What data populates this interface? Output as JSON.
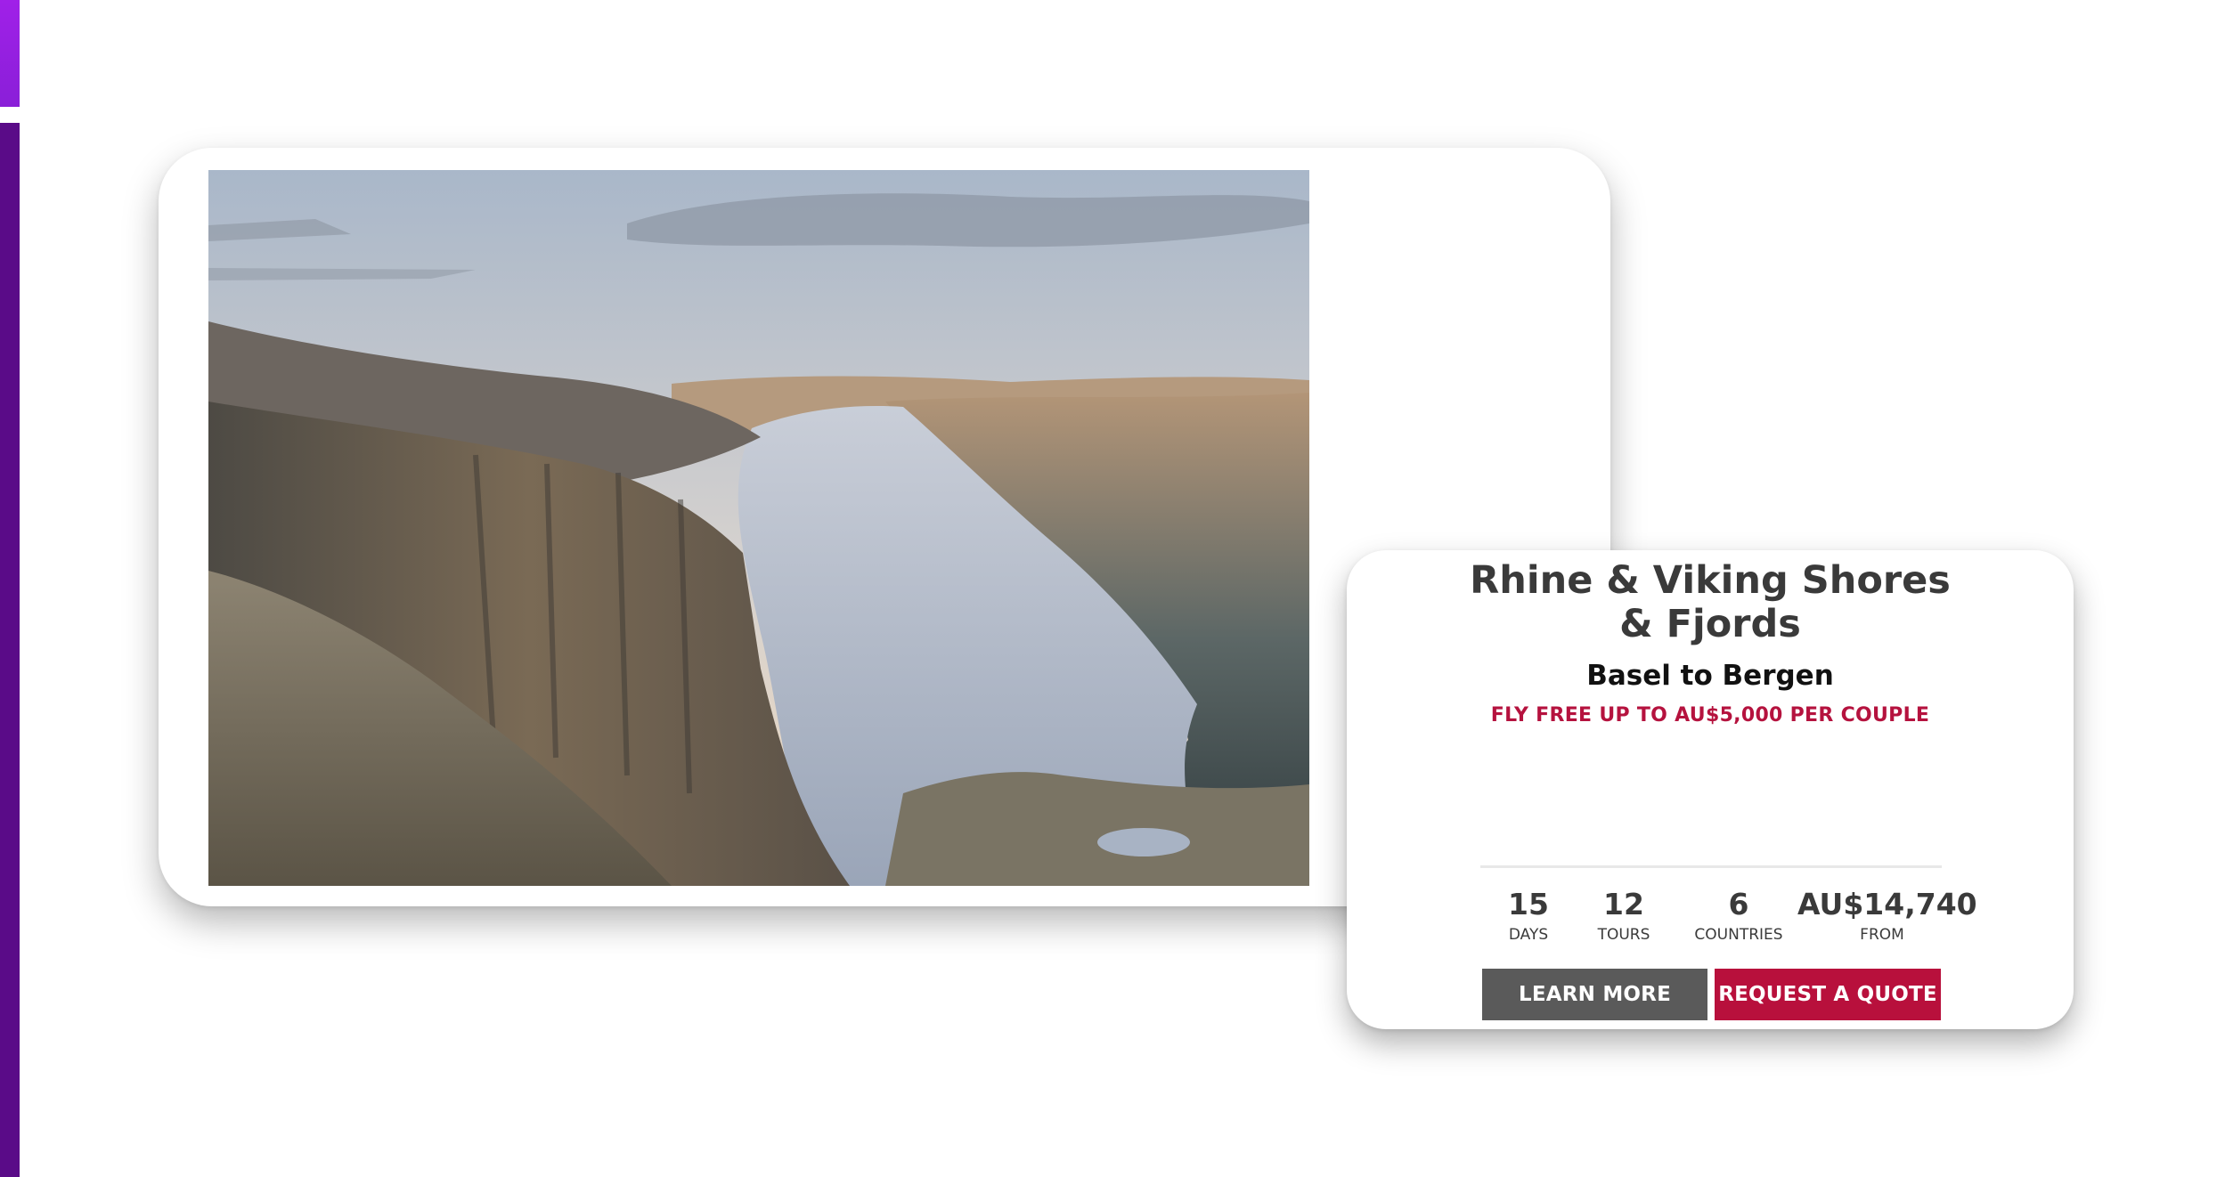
{
  "theme": {
    "accent_purple": "#a020e8",
    "accent_dark_purple": "#5a0b88",
    "brand_red": "#b8103c",
    "button_gray": "#5a5a5a"
  },
  "hero_image": {
    "subject": "Norwegian fjord with steep cliffs under a pastel sky"
  },
  "tour": {
    "title": "Rhine & Viking Shores\n& Fjords",
    "route": "Basel to Bergen",
    "offer": "FLY FREE UP TO AU$5,000 PER COUPLE",
    "stats": [
      {
        "value": "15",
        "label": "DAYS"
      },
      {
        "value": "12",
        "label": "TOURS"
      },
      {
        "value": "6",
        "label": "COUNTRIES"
      },
      {
        "value": "AU$14,740",
        "label": "FROM"
      }
    ],
    "buttons": {
      "learn_more": "LEARN MORE",
      "request_quote": "REQUEST A QUOTE"
    }
  }
}
